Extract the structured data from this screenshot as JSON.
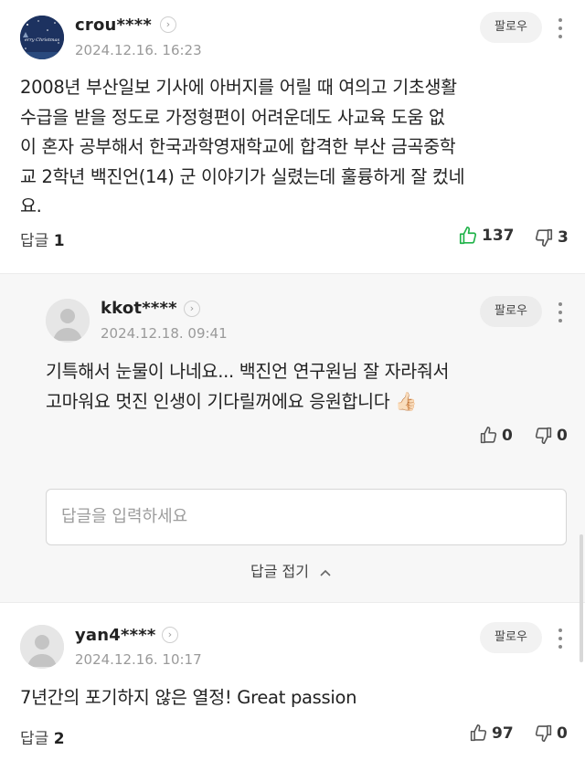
{
  "comments": [
    {
      "username": "crou****",
      "timestamp": "2024.12.16. 16:23",
      "follow_label": "팔로우",
      "avatar_caption": "erry Christmas",
      "lines": [
        "2008년 부산일보 기사에 아버지를 어릴 때 여의고 기초생활",
        "수급을 받을 정도로 가정형편이 어려운데도 사교육 도움 없",
        "이 혼자 공부해서 한국과학영재학교에 합격한 부산 금곡중학",
        "교 2학년 백진언(14) 군 이야기가 실렸는데 훌륭하게 잘 컸네",
        "요."
      ],
      "reply_label": "답글",
      "reply_count": "1",
      "likes": "137",
      "dislikes": "3"
    },
    {
      "username": "yan4****",
      "timestamp": "2024.12.16. 10:17",
      "follow_label": "팔로우",
      "lines": [
        "7년간의 포기하지 않은 열정! Great passion"
      ],
      "reply_label": "답글",
      "reply_count": "2",
      "likes": "97",
      "dislikes": "0"
    }
  ],
  "reply": {
    "username": "kkot****",
    "timestamp": "2024.12.18. 09:41",
    "follow_label": "팔로우",
    "lines": [
      "기특해서 눈물이 나네요... 백진언 연구원님 잘 자라줘서",
      "고마워요 멋진 인생이 기다릴꺼에요 응원합니다"
    ],
    "emoji": "👍🏻",
    "likes": "0",
    "dislikes": "0"
  },
  "reply_input": {
    "placeholder": "답글을 입력하세요"
  },
  "collapse_label": "답글 접기",
  "colors": {
    "like_active": "#21b34a",
    "follow_bg": "#f2f2f2",
    "reply_bg": "#f7f7f7"
  },
  "icons": [
    "chevron-right-icon",
    "more-vertical-icon",
    "thumbs-up-icon",
    "thumbs-down-icon",
    "chevron-up-icon",
    "default-avatar-icon"
  ]
}
